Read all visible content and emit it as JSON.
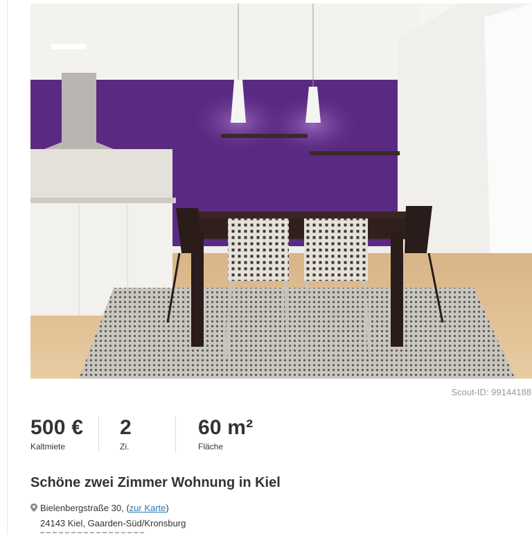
{
  "listing": {
    "scout_id": "Scout-ID: 99144188",
    "facts": [
      {
        "value": "500 €",
        "label": "Kaltmiete"
      },
      {
        "value": "2",
        "label": "Zi."
      },
      {
        "value": "60 m²",
        "label": "Fläche"
      }
    ],
    "title": "Schöne zwei Zimmer Wohnung in Kiel",
    "address": {
      "street": "Bielenbergstraße 30,",
      "map_link_open": "(",
      "map_link": "zur Karte",
      "map_link_close": ")",
      "city": "24143 Kiel, Gaarden-Süd/Kronsburg"
    }
  },
  "icons": {
    "address": "map-marker-icon"
  },
  "colors": {
    "link": "#2a7ab6",
    "wall_accent": "#5a2a82",
    "muted_text": "#999999"
  }
}
